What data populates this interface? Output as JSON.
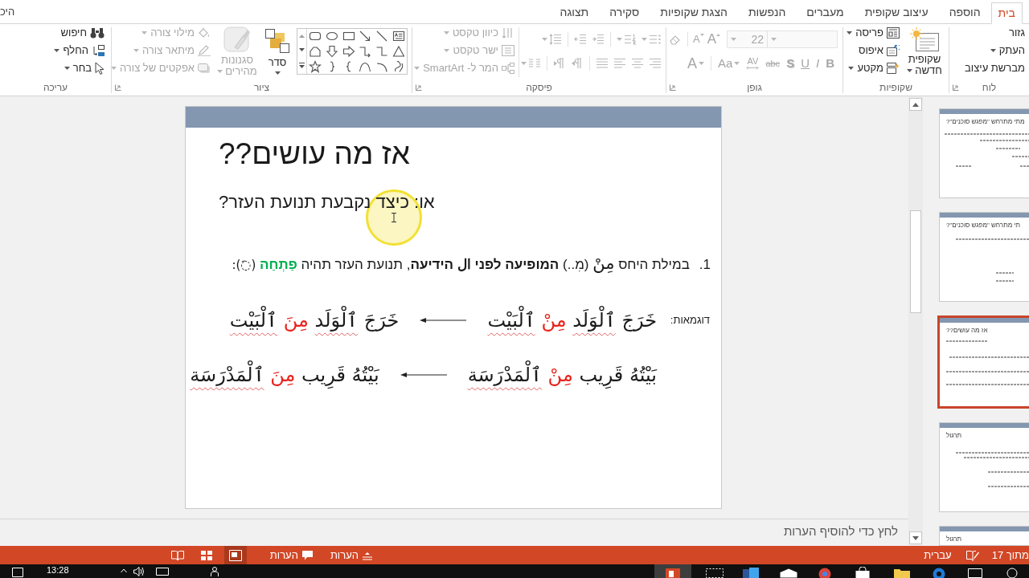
{
  "tabs_bar": {
    "tabs": [
      {
        "label": "בית",
        "selected": true
      },
      {
        "label": "הוספה",
        "selected": false
      },
      {
        "label": "עיצוב שקופית",
        "selected": false
      },
      {
        "label": "מעברים",
        "selected": false
      },
      {
        "label": "הנפשות",
        "selected": false
      },
      {
        "label": "הצגת שקופיות",
        "selected": false
      },
      {
        "label": "סקירה",
        "selected": false
      },
      {
        "label": "תצוגה",
        "selected": false
      }
    ],
    "account": "היכ"
  },
  "ribbon": {
    "clipboard": {
      "label": "לוח",
      "items": [
        {
          "label": "גזור",
          "dropdown": false
        },
        {
          "label": "העתק",
          "dropdown": true
        },
        {
          "label": "מברשת עיצוב",
          "dropdown": false
        }
      ]
    },
    "slides": {
      "label": "שקופיות",
      "new_slide": {
        "line_1": "שקופית",
        "line_2": "חדשה"
      },
      "items": [
        {
          "label": "פריסה",
          "dropdown": true
        },
        {
          "label": "איפוס",
          "dropdown": false
        },
        {
          "label": "מקטע",
          "dropdown": true
        }
      ]
    },
    "font": {
      "label": "גופן",
      "disabled": true,
      "size": "22",
      "size_buttons": [
        {
          "kind": "grow",
          "label": "A"
        },
        {
          "kind": "shrink",
          "label": "A"
        }
      ],
      "format_buttons": [
        {
          "kind": "bold",
          "label": "B"
        },
        {
          "kind": "italic",
          "label": "I"
        },
        {
          "kind": "underline",
          "label": "U"
        },
        {
          "kind": "shadow",
          "label": "S"
        },
        {
          "kind": "strike",
          "label": "abc"
        },
        {
          "kind": "spacing",
          "label": "AV"
        },
        {
          "kind": "case",
          "label": "Aa"
        },
        {
          "kind": "color",
          "label": "A"
        }
      ]
    },
    "paragraph": {
      "label": "פיסקה",
      "disabled": true,
      "text_buttons": [
        {
          "label": "כיוון טקסט",
          "dropdown": true
        },
        {
          "label": "ישר טקסט",
          "dropdown": true
        },
        {
          "label": "המר ל- SmartArt",
          "dropdown": true
        }
      ]
    },
    "drawing": {
      "label": "ציור",
      "arrange": {
        "label": "סדר",
        "disabled": false,
        "dropdown": true
      },
      "quick_styles": {
        "line_1": "סגנונות",
        "line_2": "מהירים",
        "disabled": true,
        "dropdown": true
      },
      "shape_format": [
        {
          "label": "מילוי צורה",
          "disabled": true,
          "dropdown": true
        },
        {
          "label": "מיתאר צורה",
          "disabled": true,
          "dropdown": true
        },
        {
          "label": "אפקטים של צורה",
          "disabled": true,
          "dropdown": true
        }
      ]
    },
    "editing": {
      "label": "עריכה",
      "items": [
        {
          "label": "חיפוש",
          "dropdown": false
        },
        {
          "label": "החלף",
          "dropdown": true
        },
        {
          "label": "בחר",
          "dropdown": true
        }
      ]
    }
  },
  "slide": {
    "title": "אז מה עושים??",
    "subtitle": "או: כיצד נקבעת תנועת העזר?",
    "point": {
      "number": "1.",
      "runs": [
        {
          "kind": "plain",
          "text": "במילת היחס "
        },
        {
          "kind": "arabic",
          "text": "مِنْ"
        },
        {
          "kind": "plain",
          "text": " (מִ..) "
        },
        {
          "kind": "bold",
          "text": "המופיעה לפני ال הידיעה"
        },
        {
          "kind": "plain",
          "text": ", תנועת העזר תהיה "
        },
        {
          "kind": "accent",
          "text": "פַתְחַה"
        },
        {
          "kind": "mark",
          "text": " (◌َ):"
        }
      ]
    },
    "examples": [
      {
        "label": "דוגמאות:",
        "before": [
          {
            "kind": "plain",
            "text": "خَرَجَ "
          },
          {
            "kind": "flagged",
            "text": "ٱلْوَلَد"
          },
          {
            "kind": "red",
            "text": " مِنْ "
          },
          {
            "kind": "flagged",
            "text": "ٱلْبَيْت"
          }
        ],
        "after": [
          {
            "kind": "plain",
            "text": "خَرَجَ "
          },
          {
            "kind": "flagged",
            "text": "ٱلْوَلَد"
          },
          {
            "kind": "red",
            "text": " مِنَ "
          },
          {
            "kind": "flagged",
            "text": "ٱلْبَيْت"
          }
        ]
      },
      {
        "before": [
          {
            "kind": "plain",
            "text": "بَيْتُهُ قَرِيب "
          },
          {
            "kind": "red",
            "text": "مِنْ "
          },
          {
            "kind": "flagged",
            "text": "ٱلْمَدْرَسَة"
          }
        ],
        "after": [
          {
            "kind": "plain",
            "text": "بَيْتُهُ قَرِيب "
          },
          {
            "kind": "red",
            "text": "مِنَ "
          },
          {
            "kind": "flagged",
            "text": "ٱلْمَدْرَسَة"
          }
        ]
      }
    ]
  },
  "notes": {
    "placeholder": "לחץ כדי להוסיף הערות"
  },
  "thumbnails": [
    {
      "title": "מתי מתרחש \"מפגש סוכנים\"?",
      "selected": false
    },
    {
      "title": "תי מתרחש \"מפגש סוכנים\"?",
      "selected": false
    },
    {
      "title": "אז מה עושים??",
      "selected": true
    },
    {
      "title": "תרגול",
      "selected": false
    },
    {
      "title": "תרגול",
      "selected": false
    }
  ],
  "status_bar": {
    "slide_counter": "מתוך 17",
    "language": "עברית",
    "notes": "הערות",
    "comments": "הערות",
    "views": [
      {
        "selected": true
      },
      {
        "selected": false
      },
      {
        "selected": false
      }
    ]
  },
  "taskbar": {
    "time": "13:28"
  }
}
